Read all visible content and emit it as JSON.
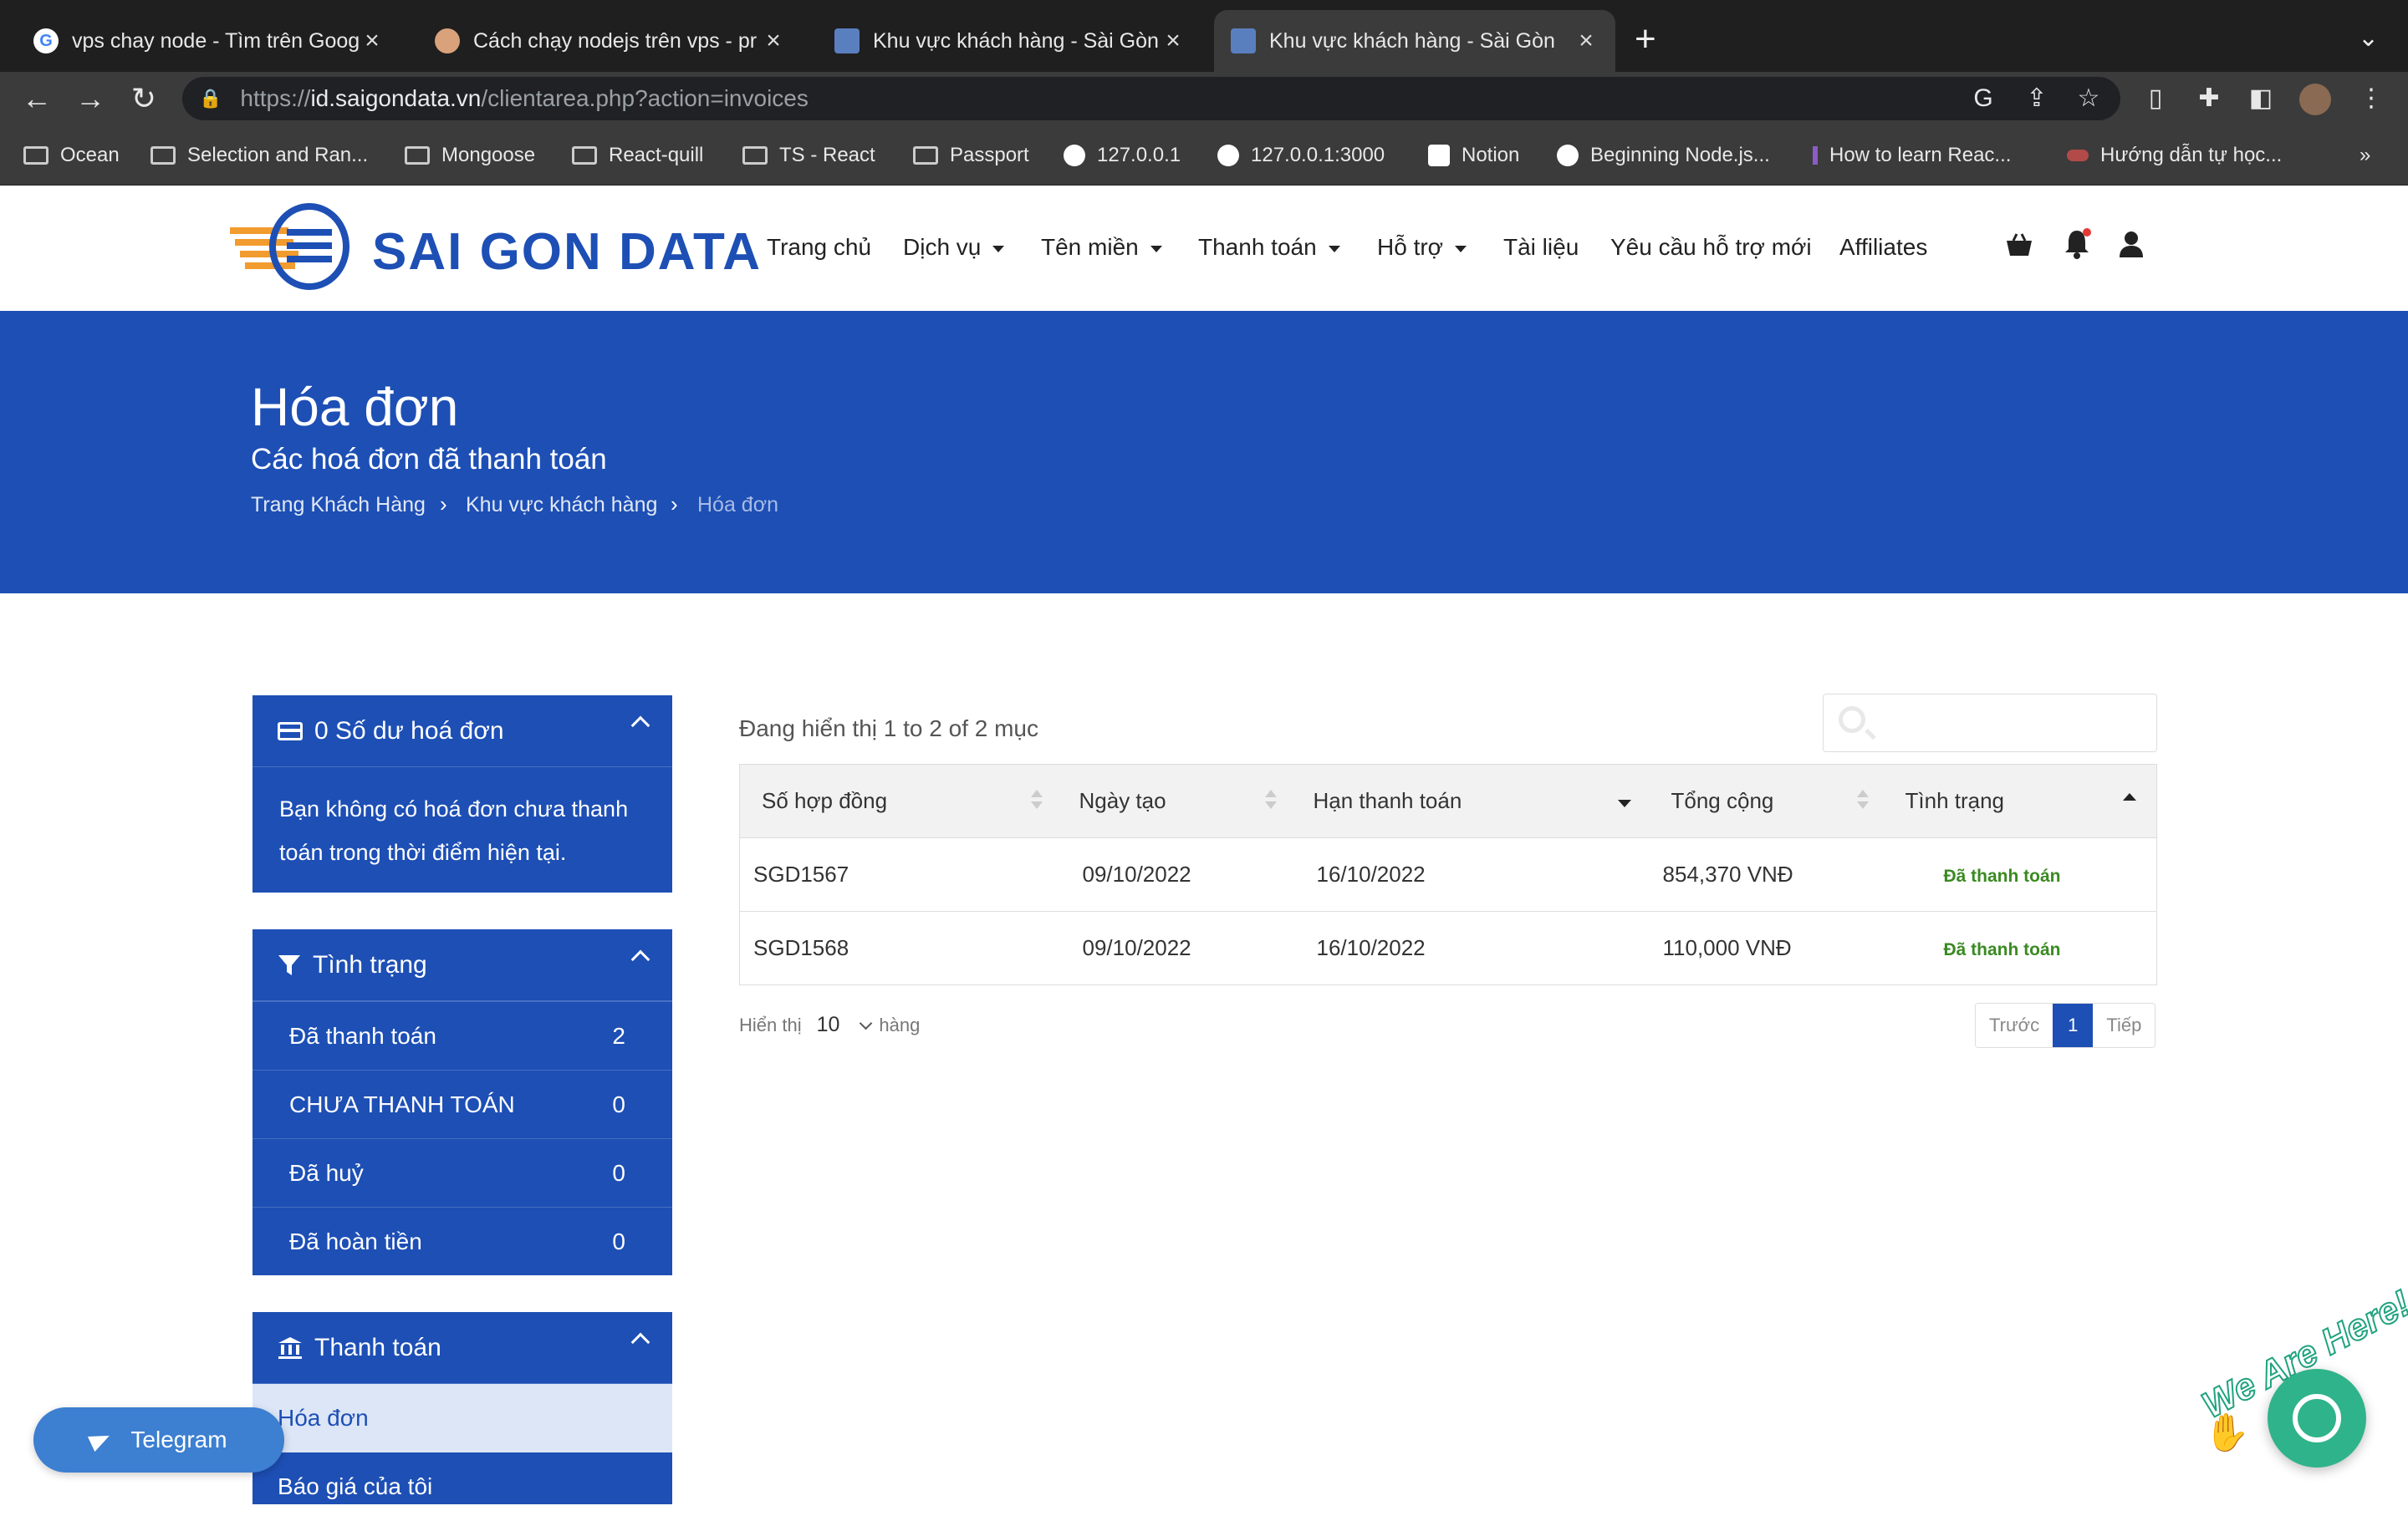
{
  "browser": {
    "tabs": [
      {
        "label": "vps chay node - Tìm trên Goog",
        "favicon": "google-icon",
        "active": false
      },
      {
        "label": "Cách chạy nodejs trên vps - pr",
        "favicon": "avatar-icon",
        "active": false
      },
      {
        "label": "Khu vực khách hàng - Sài Gòn",
        "favicon": "saigondata-icon",
        "active": false
      },
      {
        "label": "Khu vực khách hàng - Sài Gòn",
        "favicon": "saigondata-icon",
        "active": true
      }
    ],
    "url_scheme": "https://",
    "url_host": "id.saigondata.vn",
    "url_path": "/clientarea.php?action=invoices",
    "bookmarks": [
      {
        "label": "Ocean",
        "icon": "folder-icon"
      },
      {
        "label": "Selection and Ran...",
        "icon": "folder-icon"
      },
      {
        "label": "Mongoose",
        "icon": "folder-icon"
      },
      {
        "label": "React-quill",
        "icon": "folder-icon"
      },
      {
        "label": "TS - React",
        "icon": "folder-icon"
      },
      {
        "label": "Passport",
        "icon": "folder-icon"
      },
      {
        "label": "127.0.0.1",
        "icon": "triangle-icon"
      },
      {
        "label": "127.0.0.1:3000",
        "icon": "triangle-icon"
      },
      {
        "label": "Notion",
        "icon": "notion-icon"
      },
      {
        "label": "Beginning Node.js...",
        "icon": "globe-icon"
      },
      {
        "label": "How to learn Reac...",
        "icon": "bookmark-icon"
      },
      {
        "label": "Hướng dẫn tự học...",
        "icon": "bookmark-icon"
      }
    ],
    "more_bookmarks": "»"
  },
  "site": {
    "logo_text": "SAI GON DATA",
    "nav": [
      {
        "label": "Trang chủ",
        "dropdown": false
      },
      {
        "label": "Dịch vụ",
        "dropdown": true
      },
      {
        "label": "Tên miền",
        "dropdown": true
      },
      {
        "label": "Thanh toán",
        "dropdown": true
      },
      {
        "label": "Hỗ trợ",
        "dropdown": true
      },
      {
        "label": "Tài liệu",
        "dropdown": false
      },
      {
        "label": "Yêu cầu hỗ trợ mới",
        "dropdown": false
      },
      {
        "label": "Affiliates",
        "dropdown": false
      }
    ],
    "colors": {
      "brand_blue": "#1d4fb5",
      "logo_orange": "#f29b2e",
      "paid_green": "#3a8a22"
    }
  },
  "hero": {
    "title": "Hóa đơn",
    "subtitle": "Các hoá đơn đã thanh toán",
    "breadcrumb": [
      "Trang Khách Hàng",
      "Khu vực khách hàng",
      "Hóa đơn"
    ]
  },
  "sidebar": {
    "balance": {
      "title": "0 Số dư hoá đơn",
      "body": "Bạn không có hoá đơn chưa thanh toán trong thời điểm hiện tại."
    },
    "status": {
      "title": "Tình trạng",
      "items": [
        {
          "label": "Đã thanh toán",
          "count": "2"
        },
        {
          "label": "CHƯA THANH TOÁN",
          "count": "0"
        },
        {
          "label": "Đã huỷ",
          "count": "0"
        },
        {
          "label": "Đã hoàn tiền",
          "count": "0"
        }
      ]
    },
    "payment": {
      "title": "Thanh toán",
      "items": [
        "Hóa đơn",
        "Báo giá của tôi"
      ]
    }
  },
  "table": {
    "showing": "Đang hiển thị 1 to 2 of 2 mục",
    "columns": [
      "Số hợp đồng",
      "Ngày tạo",
      "Hạn thanh toán",
      "Tổng cộng",
      "Tình trạng"
    ],
    "rows": [
      {
        "id": "SGD1567",
        "created": "09/10/2022",
        "due": "16/10/2022",
        "total": "854,370 VNĐ",
        "status": "Đã thanh toán"
      },
      {
        "id": "SGD1568",
        "created": "09/10/2022",
        "due": "16/10/2022",
        "total": "110,000 VNĐ",
        "status": "Đã thanh toán"
      }
    ],
    "page_len_label": "Hiển thị",
    "page_len_value": "10",
    "page_len_suffix": "hàng",
    "pager": {
      "prev": "Trước",
      "current": "1",
      "next": "Tiếp"
    }
  },
  "widgets": {
    "telegram_label": "Telegram",
    "chat_label": "We Are Here!"
  }
}
